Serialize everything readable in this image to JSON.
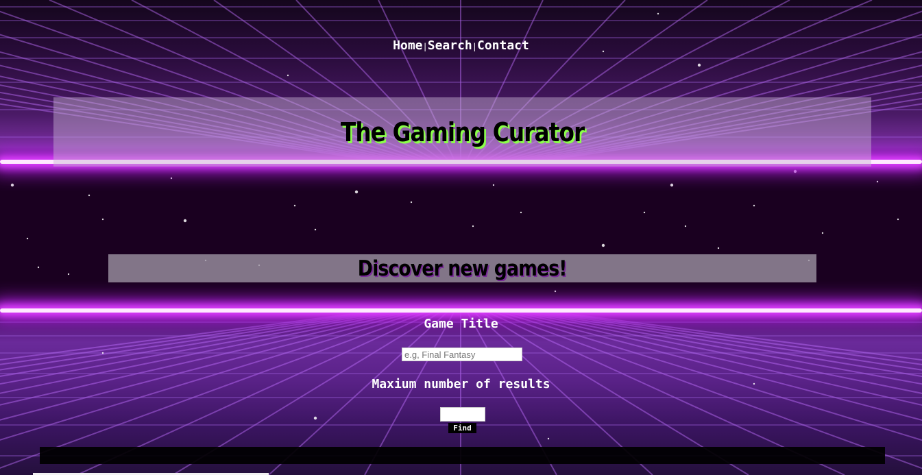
{
  "nav": {
    "items": [
      {
        "label": "Home"
      },
      {
        "label": "Search"
      },
      {
        "label": "Contact"
      }
    ],
    "separator": "|"
  },
  "header": {
    "title": "The Gaming Curator"
  },
  "hero": {
    "subtitle": "Discover new games!"
  },
  "search_form": {
    "title_label": "Game Title",
    "title_value": "",
    "title_placeholder": "e.g, Final Fantasy",
    "max_results_label": "Maxium number of results",
    "max_results_value": "",
    "find_button_label": "Find"
  },
  "colors": {
    "title_text": "#000000",
    "title_shadow": "#8bff4a",
    "neon_glow": "#e040ff",
    "banner_bg": "#c8b4d2",
    "button_bg": "#000000"
  }
}
